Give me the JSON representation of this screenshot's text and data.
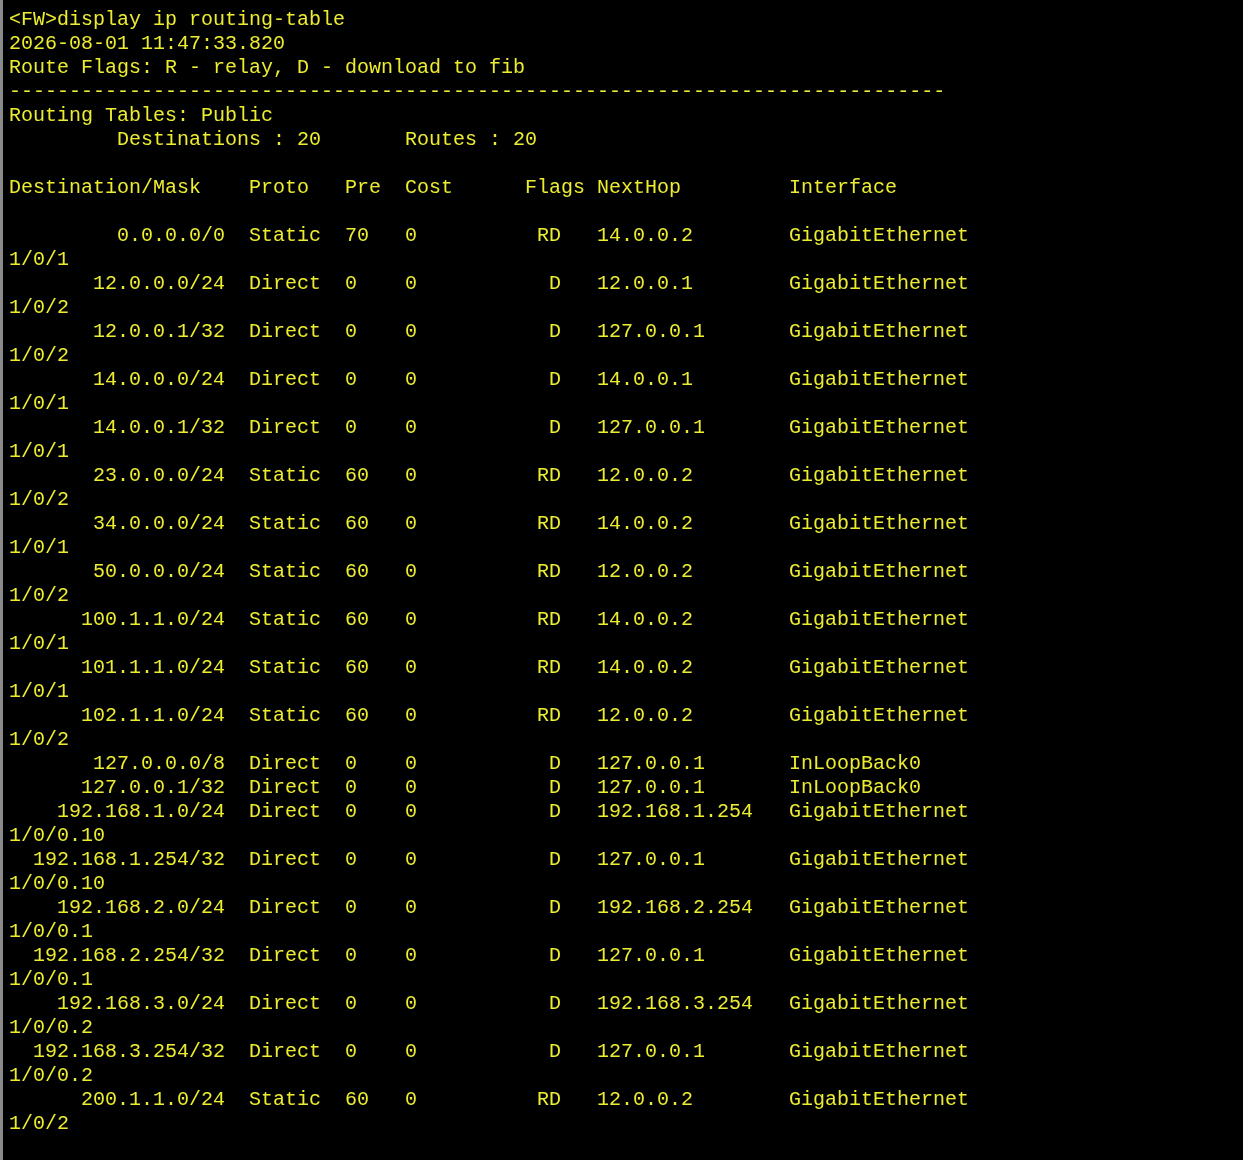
{
  "command": "<FW>display ip routing-table",
  "timestamp": "2026-08-01 11:47:33.820",
  "flags_legend": "Route Flags: R - relay, D - download to fib",
  "separator": "------------------------------------------------------------------------------",
  "table_name": "Routing Tables: Public",
  "summary": {
    "destinations": "Destinations : 20",
    "routes": "Routes : 20"
  },
  "columns": [
    "Destination/Mask",
    "Proto",
    "Pre",
    "Cost",
    "Flags",
    "NextHop",
    "Interface"
  ],
  "rows": [
    {
      "destination": "0.0.0.0/0",
      "proto": "Static",
      "pre": "70",
      "cost": "0",
      "flags": "RD",
      "nexthop": "14.0.0.2",
      "interface": "GigabitEthernet",
      "interface_wrap": "1/0/1"
    },
    {
      "destination": "12.0.0.0/24",
      "proto": "Direct",
      "pre": "0",
      "cost": "0",
      "flags": "D",
      "nexthop": "12.0.0.1",
      "interface": "GigabitEthernet",
      "interface_wrap": "1/0/2"
    },
    {
      "destination": "12.0.0.1/32",
      "proto": "Direct",
      "pre": "0",
      "cost": "0",
      "flags": "D",
      "nexthop": "127.0.0.1",
      "interface": "GigabitEthernet",
      "interface_wrap": "1/0/2"
    },
    {
      "destination": "14.0.0.0/24",
      "proto": "Direct",
      "pre": "0",
      "cost": "0",
      "flags": "D",
      "nexthop": "14.0.0.1",
      "interface": "GigabitEthernet",
      "interface_wrap": "1/0/1"
    },
    {
      "destination": "14.0.0.1/32",
      "proto": "Direct",
      "pre": "0",
      "cost": "0",
      "flags": "D",
      "nexthop": "127.0.0.1",
      "interface": "GigabitEthernet",
      "interface_wrap": "1/0/1"
    },
    {
      "destination": "23.0.0.0/24",
      "proto": "Static",
      "pre": "60",
      "cost": "0",
      "flags": "RD",
      "nexthop": "12.0.0.2",
      "interface": "GigabitEthernet",
      "interface_wrap": "1/0/2"
    },
    {
      "destination": "34.0.0.0/24",
      "proto": "Static",
      "pre": "60",
      "cost": "0",
      "flags": "RD",
      "nexthop": "14.0.0.2",
      "interface": "GigabitEthernet",
      "interface_wrap": "1/0/1"
    },
    {
      "destination": "50.0.0.0/24",
      "proto": "Static",
      "pre": "60",
      "cost": "0",
      "flags": "RD",
      "nexthop": "12.0.0.2",
      "interface": "GigabitEthernet",
      "interface_wrap": "1/0/2"
    },
    {
      "destination": "100.1.1.0/24",
      "proto": "Static",
      "pre": "60",
      "cost": "0",
      "flags": "RD",
      "nexthop": "14.0.0.2",
      "interface": "GigabitEthernet",
      "interface_wrap": "1/0/1"
    },
    {
      "destination": "101.1.1.0/24",
      "proto": "Static",
      "pre": "60",
      "cost": "0",
      "flags": "RD",
      "nexthop": "14.0.0.2",
      "interface": "GigabitEthernet",
      "interface_wrap": "1/0/1"
    },
    {
      "destination": "102.1.1.0/24",
      "proto": "Static",
      "pre": "60",
      "cost": "0",
      "flags": "RD",
      "nexthop": "12.0.0.2",
      "interface": "GigabitEthernet",
      "interface_wrap": "1/0/2"
    },
    {
      "destination": "127.0.0.0/8",
      "proto": "Direct",
      "pre": "0",
      "cost": "0",
      "flags": "D",
      "nexthop": "127.0.0.1",
      "interface": "InLoopBack0"
    },
    {
      "destination": "127.0.0.1/32",
      "proto": "Direct",
      "pre": "0",
      "cost": "0",
      "flags": "D",
      "nexthop": "127.0.0.1",
      "interface": "InLoopBack0"
    },
    {
      "destination": "192.168.1.0/24",
      "proto": "Direct",
      "pre": "0",
      "cost": "0",
      "flags": "D",
      "nexthop": "192.168.1.254",
      "interface": "GigabitEthernet",
      "interface_wrap": "1/0/0.10"
    },
    {
      "destination": "192.168.1.254/32",
      "proto": "Direct",
      "pre": "0",
      "cost": "0",
      "flags": "D",
      "nexthop": "127.0.0.1",
      "interface": "GigabitEthernet",
      "interface_wrap": "1/0/0.10"
    },
    {
      "destination": "192.168.2.0/24",
      "proto": "Direct",
      "pre": "0",
      "cost": "0",
      "flags": "D",
      "nexthop": "192.168.2.254",
      "interface": "GigabitEthernet",
      "interface_wrap": "1/0/0.1"
    },
    {
      "destination": "192.168.2.254/32",
      "proto": "Direct",
      "pre": "0",
      "cost": "0",
      "flags": "D",
      "nexthop": "127.0.0.1",
      "interface": "GigabitEthernet",
      "interface_wrap": "1/0/0.1"
    },
    {
      "destination": "192.168.3.0/24",
      "proto": "Direct",
      "pre": "0",
      "cost": "0",
      "flags": "D",
      "nexthop": "192.168.3.254",
      "interface": "GigabitEthernet",
      "interface_wrap": "1/0/0.2"
    },
    {
      "destination": "192.168.3.254/32",
      "proto": "Direct",
      "pre": "0",
      "cost": "0",
      "flags": "D",
      "nexthop": "127.0.0.1",
      "interface": "GigabitEthernet",
      "interface_wrap": "1/0/0.2"
    },
    {
      "destination": "200.1.1.0/24",
      "proto": "Static",
      "pre": "60",
      "cost": "0",
      "flags": "RD",
      "nexthop": "12.0.0.2",
      "interface": "GigabitEthernet",
      "interface_wrap": "1/0/2"
    }
  ]
}
